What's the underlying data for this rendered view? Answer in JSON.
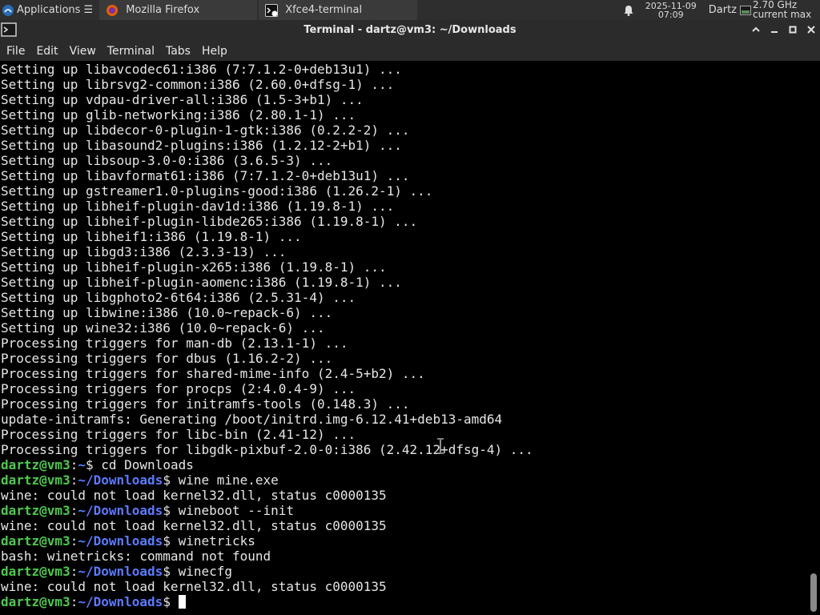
{
  "panel": {
    "apps_label": "Applications ☰",
    "tasks": [
      {
        "label": "Mozilla Firefox",
        "icon": "firefox-icon"
      },
      {
        "label": "Xfce4-terminal",
        "icon": "terminal-icon"
      }
    ],
    "clock": {
      "date": "2025-11-09",
      "time": "07:09"
    },
    "user": "Dartz",
    "cpu": {
      "freq": "2.70 GHz",
      "mode": "current max"
    }
  },
  "window": {
    "title": "Terminal - dartz@vm3: ~/Downloads"
  },
  "menu": [
    "File",
    "Edit",
    "View",
    "Terminal",
    "Tabs",
    "Help"
  ],
  "colors": {
    "prompt_user": "#4ec94e",
    "prompt_path": "#5a7bff",
    "text": "#e6e6e6"
  },
  "terminal": {
    "output": [
      "Setting up libavcodec61:i386 (7:7.1.2-0+deb13u1) ...",
      "Setting up librsvg2-common:i386 (2.60.0+dfsg-1) ...",
      "Setting up vdpau-driver-all:i386 (1.5-3+b1) ...",
      "Setting up glib-networking:i386 (2.80.1-1) ...",
      "Setting up libdecor-0-plugin-1-gtk:i386 (0.2.2-2) ...",
      "Setting up libasound2-plugins:i386 (1.2.12-2+b1) ...",
      "Setting up libsoup-3.0-0:i386 (3.6.5-3) ...",
      "Setting up libavformat61:i386 (7:7.1.2-0+deb13u1) ...",
      "Setting up gstreamer1.0-plugins-good:i386 (1.26.2-1) ...",
      "Setting up libheif-plugin-dav1d:i386 (1.19.8-1) ...",
      "Setting up libheif-plugin-libde265:i386 (1.19.8-1) ...",
      "Setting up libheif1:i386 (1.19.8-1) ...",
      "Setting up libgd3:i386 (2.3.3-13) ...",
      "Setting up libheif-plugin-x265:i386 (1.19.8-1) ...",
      "Setting up libheif-plugin-aomenc:i386 (1.19.8-1) ...",
      "Setting up libgphoto2-6t64:i386 (2.5.31-4) ...",
      "Setting up libwine:i386 (10.0~repack-6) ...",
      "Setting up wine32:i386 (10.0~repack-6) ...",
      "Processing triggers for man-db (2.13.1-1) ...",
      "Processing triggers for dbus (1.16.2-2) ...",
      "Processing triggers for shared-mime-info (2.4-5+b2) ...",
      "Processing triggers for procps (2:4.0.4-9) ...",
      "Processing triggers for initramfs-tools (0.148.3) ...",
      "update-initramfs: Generating /boot/initrd.img-6.12.41+deb13-amd64",
      "Processing triggers for libc-bin (2.41-12) ...",
      "Processing triggers for libgdk-pixbuf-2.0-0:i386 (2.42.12+dfsg-4) ..."
    ],
    "session": [
      {
        "user": "dartz@vm3",
        "path": "~",
        "cmd": "cd Downloads"
      },
      {
        "user": "dartz@vm3",
        "path": "~/Downloads",
        "cmd": "wine mine.exe"
      },
      {
        "out": "wine: could not load kernel32.dll, status c0000135"
      },
      {
        "user": "dartz@vm3",
        "path": "~/Downloads",
        "cmd": "wineboot --init"
      },
      {
        "out": "wine: could not load kernel32.dll, status c0000135"
      },
      {
        "user": "dartz@vm3",
        "path": "~/Downloads",
        "cmd": "winetricks"
      },
      {
        "out": "bash: winetricks: command not found"
      },
      {
        "user": "dartz@vm3",
        "path": "~/Downloads",
        "cmd": "winecfg"
      },
      {
        "out": "wine: could not load kernel32.dll, status c0000135"
      },
      {
        "user": "dartz@vm3",
        "path": "~/Downloads",
        "cmd": "",
        "cursor": true
      }
    ]
  }
}
